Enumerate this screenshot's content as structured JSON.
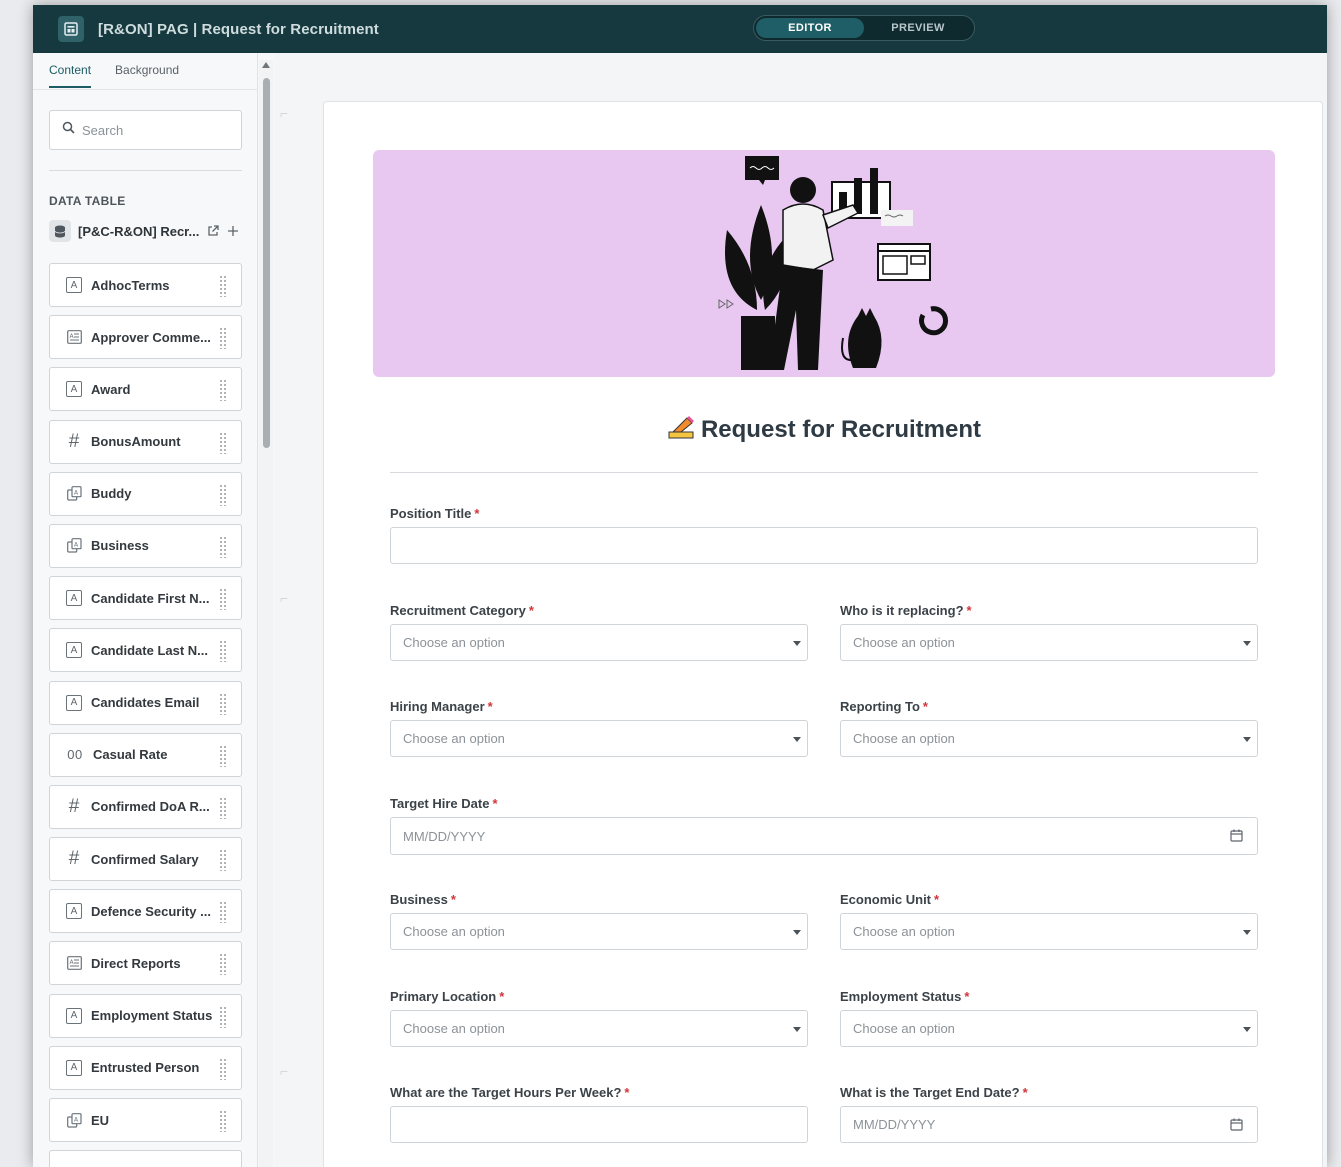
{
  "header": {
    "title": "[R&ON] PAG | Request for Recruitment",
    "modes": [
      {
        "label": "EDITOR",
        "active": true
      },
      {
        "label": "PREVIEW",
        "active": false
      }
    ]
  },
  "left_panel": {
    "tabs": [
      {
        "label": "Content",
        "active": true
      },
      {
        "label": "Background",
        "active": false
      }
    ],
    "search": {
      "placeholder": "Search",
      "value": ""
    },
    "section_label": "DATA TABLE",
    "table_name": "[P&C-R&ON] Recr...",
    "fields": [
      {
        "label": "AdhocTerms",
        "icon": "text-field-icon"
      },
      {
        "label": "Approver Comme...",
        "icon": "long-text-field-icon"
      },
      {
        "label": "Award",
        "icon": "text-field-icon"
      },
      {
        "label": "BonusAmount",
        "icon": "number-field-icon"
      },
      {
        "label": "Buddy",
        "icon": "lookup-field-icon"
      },
      {
        "label": "Business",
        "icon": "lookup-field-icon"
      },
      {
        "label": "Candidate First N...",
        "icon": "text-field-icon"
      },
      {
        "label": "Candidate Last N...",
        "icon": "text-field-icon"
      },
      {
        "label": "Candidates Email",
        "icon": "text-field-icon"
      },
      {
        "label": "Casual Rate",
        "icon": "decimal-field-icon"
      },
      {
        "label": "Confirmed DoA R...",
        "icon": "number-field-icon"
      },
      {
        "label": "Confirmed Salary",
        "icon": "number-field-icon"
      },
      {
        "label": "Defence Security ...",
        "icon": "text-field-icon"
      },
      {
        "label": "Direct Reports",
        "icon": "long-text-field-icon"
      },
      {
        "label": "Employment Status",
        "icon": "text-field-icon"
      },
      {
        "label": "Entrusted Person",
        "icon": "text-field-icon"
      },
      {
        "label": "EU",
        "icon": "lookup-field-icon"
      }
    ]
  },
  "form": {
    "title": "Request for Recruitment",
    "fields": {
      "position_title": {
        "label": "Position Title",
        "placeholder": ""
      },
      "recruitment_category": {
        "label": "Recruitment Category",
        "placeholder": "Choose an option"
      },
      "who_replacing": {
        "label": "Who is it replacing?",
        "placeholder": "Choose an option"
      },
      "hiring_manager": {
        "label": "Hiring Manager",
        "placeholder": "Choose an option"
      },
      "reporting_to": {
        "label": "Reporting To",
        "placeholder": "Choose an option"
      },
      "target_hire_date": {
        "label": "Target Hire Date",
        "placeholder": "MM/DD/YYYY"
      },
      "business": {
        "label": "Business",
        "placeholder": "Choose an option"
      },
      "economic_unit": {
        "label": "Economic Unit",
        "placeholder": "Choose an option"
      },
      "primary_location": {
        "label": "Primary Location",
        "placeholder": "Choose an option"
      },
      "employment_status": {
        "label": "Employment Status",
        "placeholder": "Choose an option"
      },
      "target_hours": {
        "label": "What are the Target Hours Per Week?",
        "placeholder": ""
      },
      "target_end_date": {
        "label": "What is the Target End Date?",
        "placeholder": "MM/DD/YYYY"
      }
    },
    "required_marker": "*"
  },
  "colors": {
    "header_bg": "#15393e",
    "banner_bg": "#e8c8f1",
    "required": "#d0363b",
    "accent": "#1c5b64"
  }
}
